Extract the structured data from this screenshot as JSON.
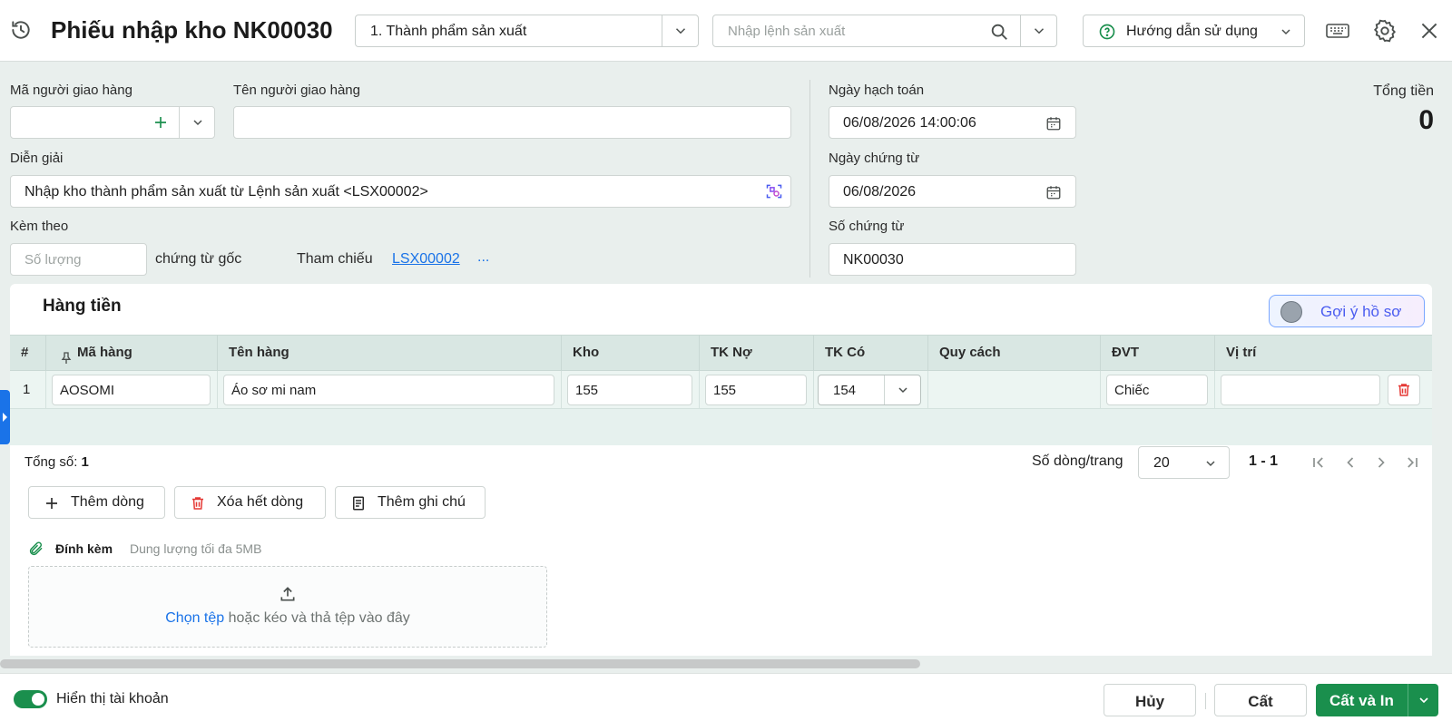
{
  "header": {
    "title": "Phiếu nhập kho NK00030",
    "type_select": "1. Thành phẩm sản xuất",
    "search_placeholder": "Nhập lệnh sản xuất",
    "help_label": "Hướng dẫn sử dụng"
  },
  "form": {
    "deliverer_code_label": "Mã người giao hàng",
    "deliverer_name_label": "Tên người giao hàng",
    "description_label": "Diễn giải",
    "description_value": "Nhập kho thành phẩm sản xuất từ Lệnh sản xuất <LSX00002>",
    "attach_label": "Kèm theo",
    "quantity_placeholder": "Số lượng",
    "original_docs_label": "chứng từ gốc",
    "reference_label": "Tham chiếu",
    "reference_link": "LSX00002",
    "reference_more": "...",
    "accounting_date_label": "Ngày hạch toán",
    "accounting_date_value": "06/08/2026 14:00:06",
    "doc_date_label": "Ngày chứng từ",
    "doc_date_value": "06/08/2026",
    "doc_no_label": "Số chứng từ",
    "doc_no_value": "NK00030",
    "total_label": "Tổng tiền",
    "total_value": "0"
  },
  "items_panel": {
    "title": "Hàng tiền",
    "suggest_label": "Gợi ý hồ sơ",
    "columns": [
      "#",
      "Mã hàng",
      "Tên hàng",
      "Kho",
      "TK Nợ",
      "TK Có",
      "Quy cách",
      "ĐVT",
      "Vị trí"
    ],
    "rows": [
      {
        "index": "1",
        "code": "AOSOMI",
        "name": "Áo sơ mi nam",
        "warehouse": "155",
        "debit": "155",
        "credit": "154",
        "spec": "",
        "unit": "Chiếc",
        "position": ""
      }
    ],
    "total_label": "Tổng số:",
    "total_count": "1",
    "per_page_label": "Số dòng/trang",
    "per_page_value": "20",
    "range": "1 - 1",
    "add_row": "Thêm dòng",
    "delete_rows": "Xóa hết dòng",
    "add_note": "Thêm ghi chú"
  },
  "attachment": {
    "label": "Đính kèm",
    "hint": "Dung lượng tối đa 5MB",
    "choose": "Chọn tệp",
    "drop_text": "hoặc kéo và thả tệp vào đây"
  },
  "footer": {
    "show_accounts_label": "Hiển thị tài khoản",
    "cancel": "Hủy",
    "save": "Cất",
    "save_print": "Cất và In"
  },
  "colors": {
    "primary": "#1a8f4d",
    "link": "#1a73e8",
    "danger": "#e53935",
    "grid_header": "#d9e7e3"
  },
  "icons": [
    "history-icon",
    "chevron-down-icon",
    "search-icon",
    "help-circle-icon",
    "keyboard-icon",
    "gear-icon",
    "close-icon",
    "plus-icon",
    "calendar-icon",
    "ai-scan-icon",
    "pin-icon",
    "trash-icon",
    "note-icon",
    "paperclip-icon",
    "upload-icon",
    "first-page-icon",
    "prev-page-icon",
    "next-page-icon",
    "last-page-icon"
  ]
}
